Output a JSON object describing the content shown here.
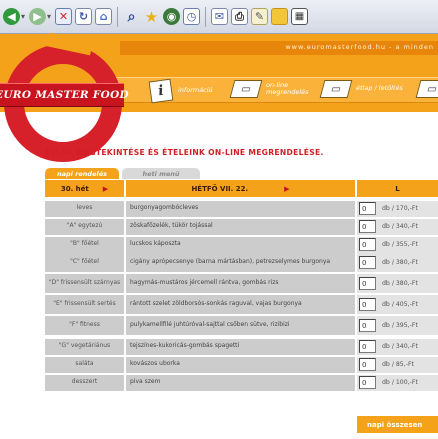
{
  "browser": {
    "icons": [
      "back-icon",
      "forward-icon",
      "document-icon",
      "stop-icon",
      "home-icon",
      "search-icon",
      "favorites-icon",
      "media-icon",
      "history-icon",
      "mail-icon",
      "print-icon",
      "edit-icon",
      "folder-icon",
      "grid-icon"
    ]
  },
  "header": {
    "site_url": "www.euromasterfood.hu - a minden",
    "logo_text": "EURO MASTER FOOD",
    "nav": [
      {
        "label": "információ",
        "icon": "i"
      },
      {
        "label": "on-line megrendelés",
        "icon": ""
      },
      {
        "label": "étlap / letöltés",
        "icon": ""
      }
    ]
  },
  "main": {
    "title": "ÉTLAP MEGTEKINTÉSE ÉS ÉTELEINK ON-LINE MEGRENDELÉSE.",
    "tabs": [
      {
        "label": "napi rendelés",
        "active": true
      },
      {
        "label": "heti menü",
        "active": false
      }
    ],
    "table_header": {
      "week": "30. hét",
      "day": "HÉTFŐ VII. 22.",
      "size": "L"
    },
    "rows": [
      {
        "category": "leves",
        "dish": "burgonyagombócleves",
        "qty": "0",
        "price": "db / 170,-Ft"
      },
      {
        "category": "\"A\" egytezú",
        "dish": "zöskafőzelék, tükör tojással",
        "qty": "0",
        "price": "db / 340,-Ft"
      },
      {
        "category": "\"B\" főétel",
        "dish": "lucskos káposzta",
        "qty": "0",
        "price": "db / 355,-Ft"
      },
      {
        "category": "\"C\" főétel",
        "dish": "cigány aprópecsenye (barna mártásban), petrezselymes burgonya",
        "qty": "0",
        "price": "db / 380,-Ft"
      },
      {
        "category": "\"D\" frissensült szárnyas",
        "dish": "hagymás-mustáros jércemell rántva, gombás rizs",
        "qty": "0",
        "price": "db / 380,-Ft"
      },
      {
        "category": "\"E\" frissensült sertés",
        "dish": "rántott szelet zöldborsós-sonkás raguval, vajas burgonya",
        "qty": "0",
        "price": "db / 405,-Ft"
      },
      {
        "category": "\"F\" fitness",
        "dish": "pulykamellfilé juhtúróval-sajttal csőben sütve, rizibizi",
        "qty": "0",
        "price": "db / 395,-Ft"
      },
      {
        "category": "\"G\" vegetáriánus",
        "dish": "tejszínes-kukoricás-gombás spagetti",
        "qty": "0",
        "price": "db / 340,-Ft"
      },
      {
        "category": "saláta",
        "dish": "kovászos uborka",
        "qty": "0",
        "price": "db / 85,-Ft"
      },
      {
        "category": "desszert",
        "dish": "piva szem",
        "qty": "0",
        "price": "db / 100,-Ft"
      }
    ],
    "total_label": "napi összesen"
  }
}
